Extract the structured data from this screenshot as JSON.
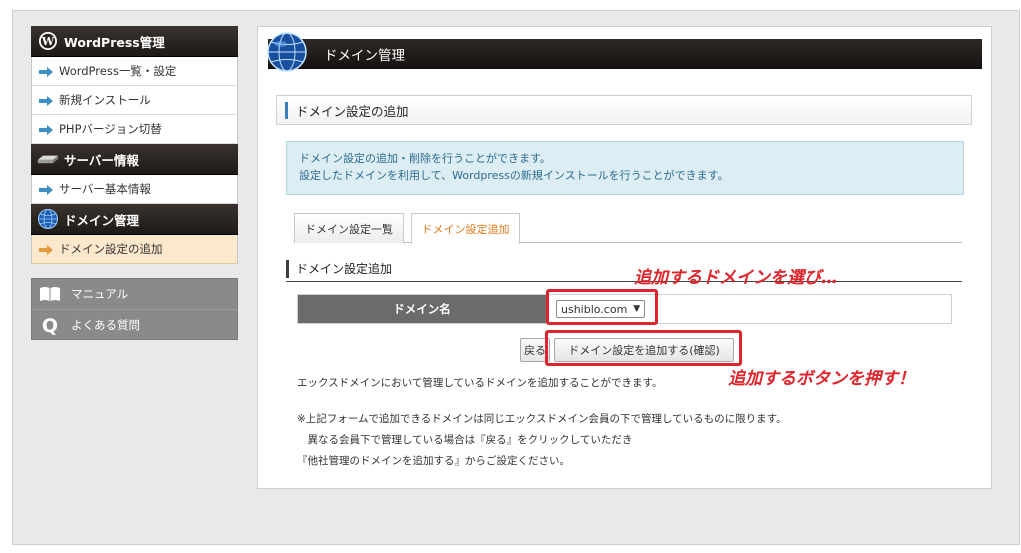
{
  "sidebar": {
    "wordpress": {
      "title": "WordPress管理",
      "items": [
        {
          "label": "WordPress一覧・設定"
        },
        {
          "label": "新規インストール"
        },
        {
          "label": "PHPバージョン切替"
        }
      ]
    },
    "server": {
      "title": "サーバー情報",
      "items": [
        {
          "label": "サーバー基本情報"
        }
      ]
    },
    "domain": {
      "title": "ドメイン管理",
      "items": [
        {
          "label": "ドメイン設定の追加"
        }
      ]
    },
    "help": [
      {
        "label": "マニュアル"
      },
      {
        "label": "よくある質問"
      }
    ]
  },
  "main": {
    "title": "ドメイン管理",
    "section_title": "ドメイン設定の追加",
    "info_lines": [
      "ドメイン設定の追加・削除を行うことができます。",
      "設定したドメインを利用して、Wordpressの新規インストールを行うことができます。"
    ],
    "tabs": [
      {
        "label": "ドメイン設定一覧"
      },
      {
        "label": "ドメイン設定追加"
      }
    ],
    "form_title": "ドメイン設定追加",
    "form": {
      "label": "ドメイン名",
      "selected": "ushiblo.com"
    },
    "buttons": {
      "back": "戻る",
      "add": "ドメイン設定を追加する(確認)"
    },
    "notes": [
      "エックスドメインにおいて管理しているドメインを追加することができます。",
      "※上記フォームで追加できるドメインは同じエックスドメイン会員の下で管理しているものに限ります。",
      "　異なる会員下で管理している場合は『戻る』をクリックしていただき",
      "『他社管理のドメインを追加する』からご設定ください。"
    ]
  },
  "annotations": {
    "select_note": "追加するドメインを選び…",
    "button_note": "追加するボタンを押す！",
    "color": "#e0242b"
  }
}
